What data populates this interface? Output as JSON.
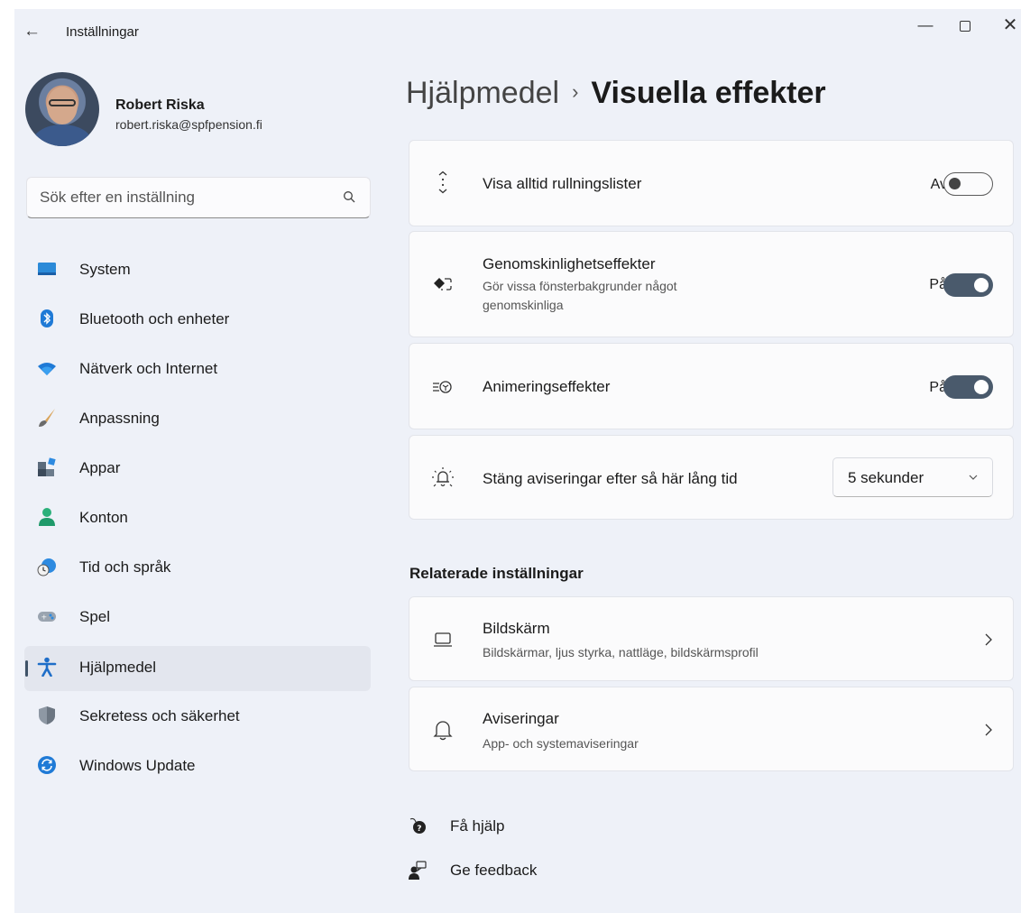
{
  "window": {
    "app_title": "Inställningar"
  },
  "profile": {
    "name": "Robert Riska",
    "email": "robert.riska@spfpension.fi"
  },
  "search": {
    "placeholder": "Sök efter en inställning"
  },
  "sidebar": {
    "items": [
      {
        "label": "System",
        "icon": "monitor-icon"
      },
      {
        "label": "Bluetooth och enheter",
        "icon": "bluetooth-icon"
      },
      {
        "label": "Nätverk och Internet",
        "icon": "wifi-icon"
      },
      {
        "label": "Anpassning",
        "icon": "brush-icon"
      },
      {
        "label": "Appar",
        "icon": "apps-icon"
      },
      {
        "label": "Konton",
        "icon": "person-icon"
      },
      {
        "label": "Tid och språk",
        "icon": "globe-clock-icon"
      },
      {
        "label": "Spel",
        "icon": "gamepad-icon"
      },
      {
        "label": "Hjälpmedel",
        "icon": "accessibility-icon",
        "selected": true
      },
      {
        "label": "Sekretess och säkerhet",
        "icon": "shield-icon"
      },
      {
        "label": "Windows Update",
        "icon": "update-icon"
      }
    ]
  },
  "breadcrumb": {
    "parent": "Hjälpmedel",
    "separator": "›",
    "current": "Visuella effekter"
  },
  "settings": {
    "scrollbars": {
      "title": "Visa alltid rullningslister",
      "state": "Av",
      "on": false
    },
    "transparency": {
      "title": "Genomskinlighetseffekter",
      "desc_line1": "Gör vissa fönsterbakgrunder något",
      "desc_line2": "genomskinliga",
      "state": "På",
      "on": true
    },
    "animation": {
      "title": "Animeringseffekter",
      "state": "På",
      "on": true
    },
    "notifications": {
      "title": "Stäng aviseringar efter så här lång tid",
      "value": "5 sekunder"
    }
  },
  "related": {
    "title": "Relaterade inställningar",
    "display": {
      "title": "Bildskärm",
      "desc": "Bildskärmar, ljus styrka, nattläge, bildskärmsprofil"
    },
    "notifications": {
      "title": "Aviseringar",
      "desc": "App- och systemaviseringar"
    }
  },
  "footer": {
    "help": "Få hjälp",
    "feedback": "Ge feedback"
  },
  "colors": {
    "toggle_on": "#4a5a6c",
    "background": "#eef1f8",
    "card": "#fbfbfc"
  }
}
